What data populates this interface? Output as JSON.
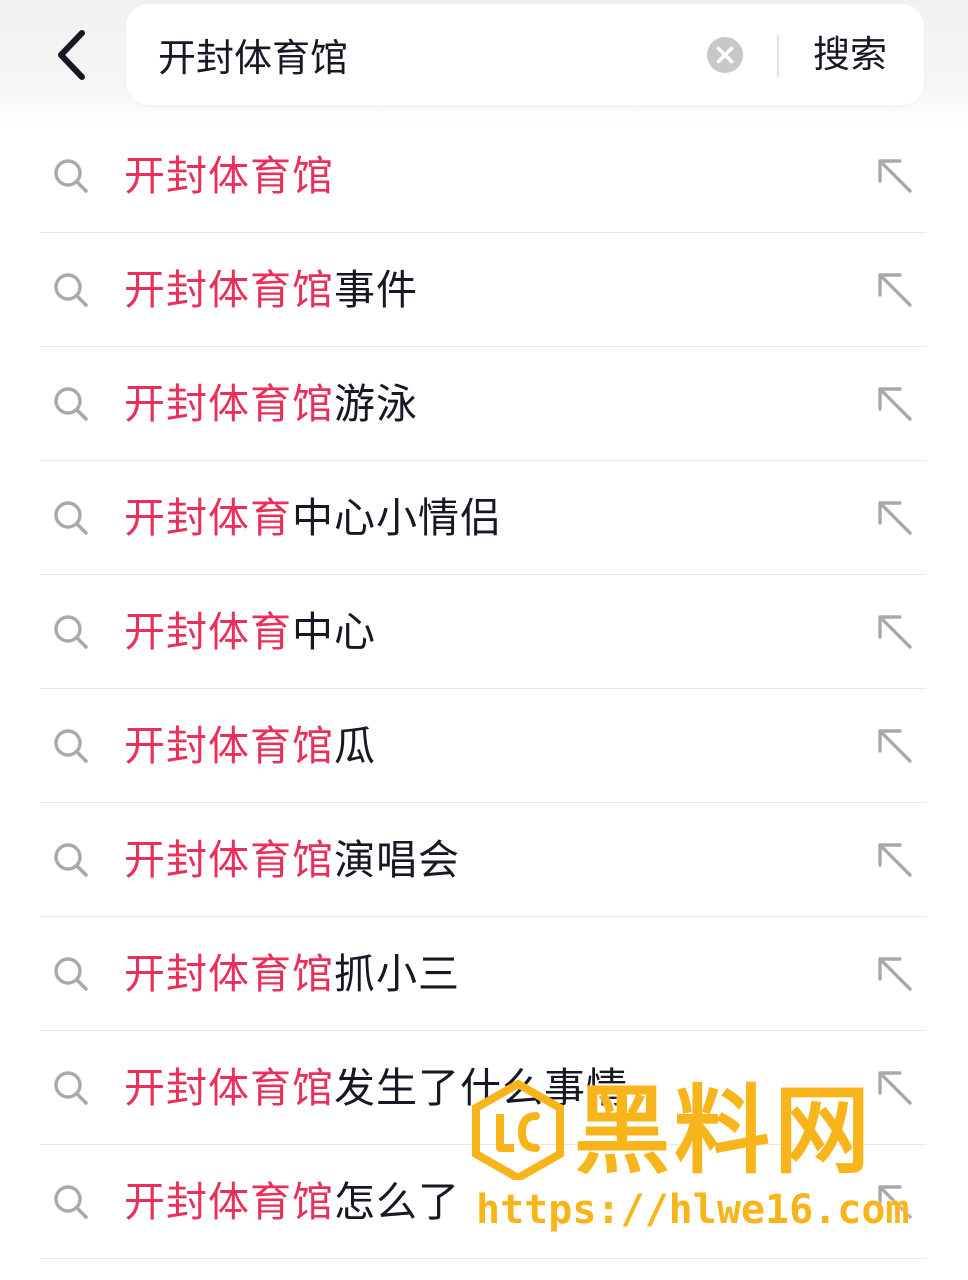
{
  "header": {
    "back_icon": "chevron-left-icon",
    "search_value": "开封体育馆",
    "clear_icon": "clear-circle-icon",
    "search_button_label": "搜索"
  },
  "suggestions": [
    {
      "highlight": "开封体育馆",
      "rest": ""
    },
    {
      "highlight": "开封体育馆",
      "rest": "事件"
    },
    {
      "highlight": "开封体育馆",
      "rest": "游泳"
    },
    {
      "highlight": "开封体育",
      "rest": "中心小情侣"
    },
    {
      "highlight": "开封体育",
      "rest": "中心"
    },
    {
      "highlight": "开封体育馆",
      "rest": "瓜"
    },
    {
      "highlight": "开封体育馆",
      "rest": "演唱会"
    },
    {
      "highlight": "开封体育馆",
      "rest": "抓小三"
    },
    {
      "highlight": "开封体育馆",
      "rest": "发生了什么事情"
    },
    {
      "highlight": "开封体育馆",
      "rest": "怎么了"
    }
  ],
  "watermark": {
    "title": "黑料网",
    "url": "https://hlwe16.com"
  },
  "colors": {
    "highlight": "#e8305a",
    "text": "#161823",
    "icon": "#a9a9ad",
    "watermark": "#f7b51b"
  }
}
